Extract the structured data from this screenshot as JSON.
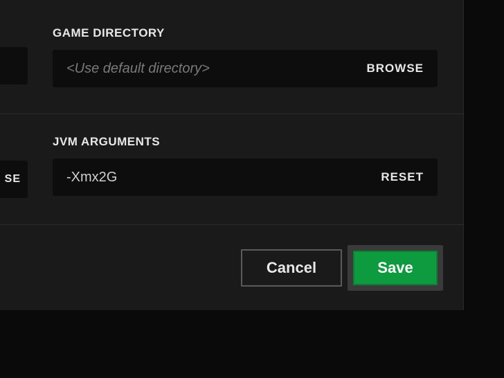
{
  "sections": {
    "directory": {
      "header": "GAME DIRECTORY",
      "placeholder": "<Use default directory>",
      "value": "",
      "action": "BROWSE"
    },
    "jvm": {
      "header": "JVM ARGUMENTS",
      "placeholder": "",
      "value": "-Xmx2G",
      "action": "RESET"
    }
  },
  "cutLabel": "SE",
  "footer": {
    "cancel": "Cancel",
    "save": "Save"
  }
}
